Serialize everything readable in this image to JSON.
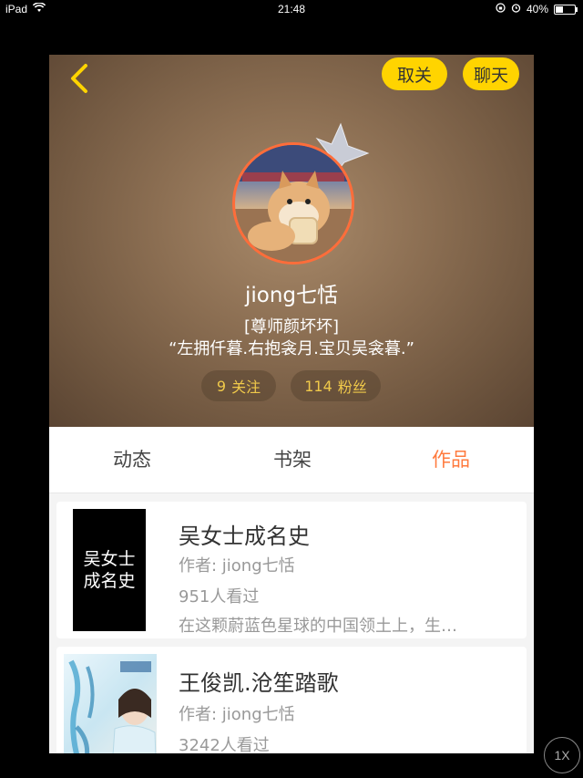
{
  "status_bar": {
    "device": "iPad",
    "time": "21:48",
    "battery": "40%",
    "battery_level": 0.4
  },
  "header": {
    "unfollow_label": "取关",
    "chat_label": "聊天",
    "username": "jiong七恬",
    "title_badge": "[尊师颜坏坏]",
    "motto": "“左拥仟暮.右抱衾月.宝贝吴衾暮.”",
    "follow_count": "9",
    "follow_label": "关注",
    "fans_count": "114",
    "fans_label": "粉丝"
  },
  "tabs": {
    "dynamics": "动态",
    "bookshelf": "书架",
    "works": "作品",
    "active": "works"
  },
  "works": [
    {
      "cover_text_line1": "吴女士",
      "cover_text_line2": "成名史",
      "title": "吴女士成名史",
      "author": "作者: jiong七恬",
      "views": "951人看过",
      "summary": "在这颗蔚蓝色星球的中国领土上，生…"
    },
    {
      "title": "王俊凯.沧笙踏歌",
      "author": "作者: jiong七恬",
      "views": "3242人看过"
    }
  ],
  "speed_label": "1X",
  "colors": {
    "accent_yellow": "#ffd400",
    "active_tab": "#ff7a3d",
    "stat_text": "#f0c94a"
  }
}
